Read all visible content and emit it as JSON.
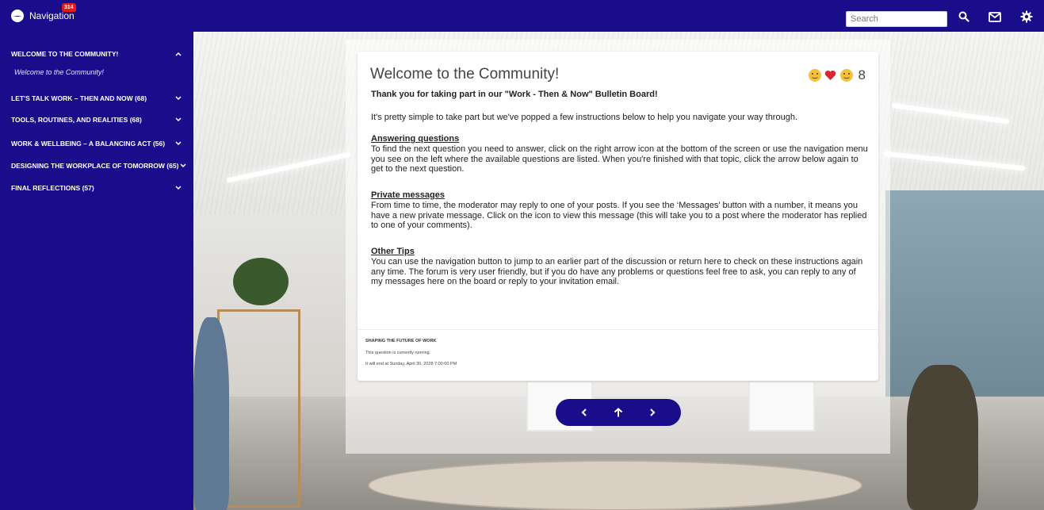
{
  "topbar": {
    "nav_label": "Navigation",
    "nav_badge": "314",
    "search_placeholder": "Search",
    "icons": [
      "compass-icon",
      "search-icon",
      "mail-icon",
      "gear-icon"
    ]
  },
  "sidebar": {
    "items": [
      {
        "label": "WELCOME TO THE COMMUNITY!",
        "expanded": true
      },
      {
        "label": "LET'S TALK WORK – THEN AND NOW (68)",
        "expanded": false
      },
      {
        "label": "TOOLS, ROUTINES, AND REALITIES (68)",
        "expanded": false
      },
      {
        "label": "WORK & WELLBEING – A BALANCING ACT (56)",
        "expanded": false
      },
      {
        "label": "DESIGNING THE WORKPLACE OF TOMORROW (65)",
        "expanded": false
      },
      {
        "label": "FINAL REFLECTIONS (57)",
        "expanded": false
      }
    ],
    "sub_items": [
      "Welcome to the Community!"
    ]
  },
  "card": {
    "title": "Welcome to the Community!",
    "reaction_count": "8",
    "intro": "Thank you for taking part in our \"Work - Then & Now\" Bulletin Board!",
    "paragraph1": "It's pretty simple to take part but we've popped a few instructions below to help you navigate your way through.",
    "sections": [
      {
        "heading": "Answering questions",
        "text": "To find the next question you need to answer, click on the right arrow icon at the bottom of the screen or use the navigation menu you see on the left where the available questions are listed.  When you're finished with that topic, click the arrow below again to get to the next question."
      },
      {
        "heading": "Private messages",
        "text": "From time to time, the moderator may reply to one of your posts. If you see the ‘Messages’ button with a number, it means you have a new private message. Click on the icon to view this message (this will take you to a post where the moderator has replied to one of your comments)."
      },
      {
        "heading": "Other Tips",
        "text": "You can use the navigation button to jump to an earlier part of the discussion or return here to check on these instructions again any time.  The forum is very user friendly, but if you do have any problems or questions feel free to ask, you can reply to any of my messages here on the board or reply to your invitation email."
      }
    ],
    "footer": {
      "label": "SHAPING THE FUTURE OF WORK",
      "status": "This question is currently running.",
      "end": "It will end at Sunday, April 30, 2028 7:00:00 PM"
    }
  },
  "pager": {
    "icons": [
      "chevron-left-icon",
      "arrow-up-icon",
      "chevron-right-icon"
    ]
  },
  "colors": {
    "brand": "#1a0d8c",
    "badge": "#e21b1b",
    "heart": "#e0242f",
    "emoji": "#f3c23a"
  }
}
